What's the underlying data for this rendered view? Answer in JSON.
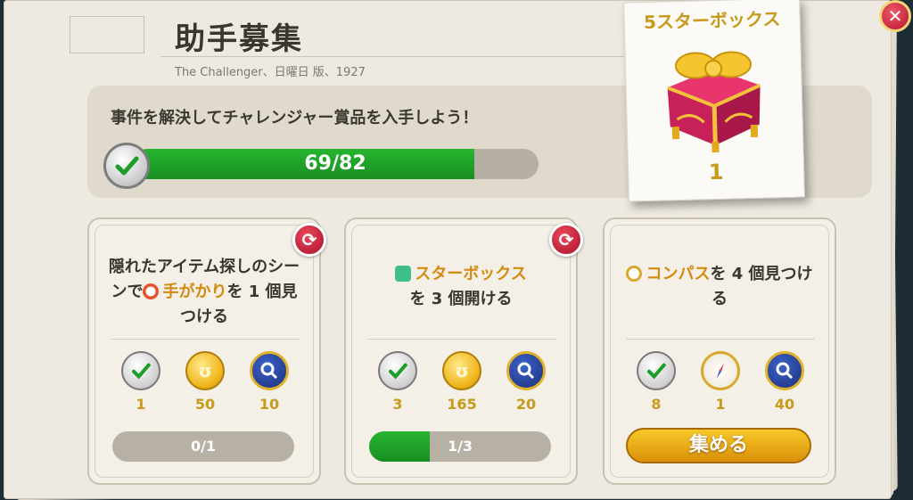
{
  "header": {
    "title": "助手募集",
    "subtitle": "The Challenger、日曜日 版、1927"
  },
  "progress": {
    "instruction": "事件を解決してチャレンジャー賞品を入手しよう！",
    "label": "69/82",
    "current": 69,
    "total": 82
  },
  "prize": {
    "title": "5スターボックス",
    "count": "1"
  },
  "cards": [
    {
      "text_parts": [
        "隠れたアイテム探しのシーンで",
        "手がかり",
        "を 1 個見つける"
      ],
      "rewards": [
        {
          "icon": "check-icon",
          "value": "1"
        },
        {
          "icon": "coin-icon",
          "value": "50"
        },
        {
          "icon": "magnifier-badge-icon",
          "value": "10"
        }
      ],
      "progress_label": "0/1",
      "progress_fraction": 0.0
    },
    {
      "text_parts": [
        "スターボックス",
        "を 3 個開ける"
      ],
      "rewards": [
        {
          "icon": "check-icon",
          "value": "3"
        },
        {
          "icon": "coin-icon",
          "value": "165"
        },
        {
          "icon": "magnifier-badge-icon",
          "value": "20"
        }
      ],
      "progress_label": "1/3",
      "progress_fraction": 0.333
    },
    {
      "text_parts": [
        "コンパス",
        "を 4 個見つける"
      ],
      "rewards": [
        {
          "icon": "check-icon",
          "value": "8"
        },
        {
          "icon": "compass-icon",
          "value": "1"
        },
        {
          "icon": "magnifier-badge-icon",
          "value": "40"
        }
      ],
      "collect_label": "集める"
    }
  ],
  "colors": {
    "accent_gold": "#d28a10",
    "progress_green": "#26b52f",
    "close_red": "#c8192f"
  }
}
